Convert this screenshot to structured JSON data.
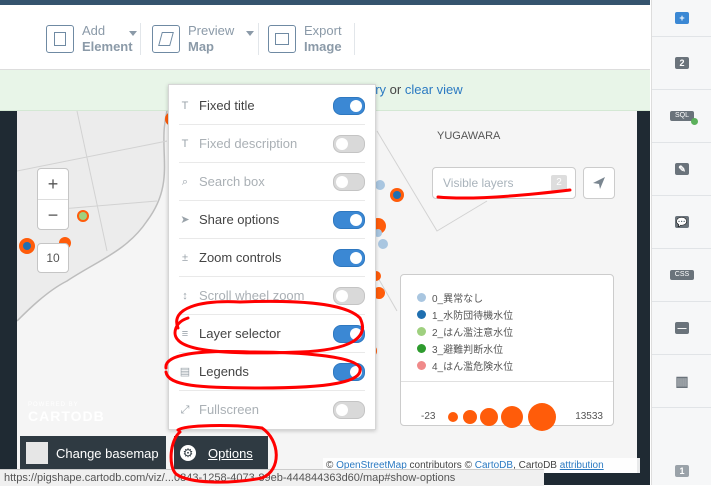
{
  "toolbar": {
    "add_element": {
      "line1": "Add",
      "line2": "Element"
    },
    "preview_map": {
      "line1": "Preview",
      "line2": "Map"
    },
    "export_image": {
      "line1": "Export",
      "line2": "Image"
    }
  },
  "notice": {
    "prefix": "ery",
    "middle": " or ",
    "link": "clear view"
  },
  "map": {
    "place_label": "YUGAWARA",
    "zoom_in": "+",
    "zoom_out": "−",
    "zoom_level": "10",
    "layers_label": "Visible layers",
    "layers_count": "2",
    "powered_small": "POWERED BY",
    "powered_brand": "CARTODB"
  },
  "legend": {
    "items": [
      {
        "label": "0_異常なし",
        "color": "#a9c6e0"
      },
      {
        "label": "1_水防団待機水位",
        "color": "#1f6fb0"
      },
      {
        "label": "2_はん濫注意水位",
        "color": "#9fd07f"
      },
      {
        "label": "3_避難判断水位",
        "color": "#2e9b2e"
      },
      {
        "label": "4_はん濫危険水位",
        "color": "#f08a8a"
      }
    ],
    "min": "-23",
    "max": "13533",
    "bubble_color": "#ff5c0a"
  },
  "options_panel": {
    "items": [
      {
        "label": "Fixed title",
        "on": true,
        "icon": "T"
      },
      {
        "label": "Fixed description",
        "on": false,
        "icon": "T"
      },
      {
        "label": "Search box",
        "on": false,
        "icon": "⌕"
      },
      {
        "label": "Share options",
        "on": true,
        "icon": "➤"
      },
      {
        "label": "Zoom controls",
        "on": true,
        "icon": "±"
      },
      {
        "label": "Scroll wheel zoom",
        "on": false,
        "icon": "↕"
      },
      {
        "label": "Layer selector",
        "on": true,
        "icon": "≡"
      },
      {
        "label": "Legends",
        "on": true,
        "icon": "▤"
      },
      {
        "label": "Fullscreen",
        "on": false,
        "icon": "⤢"
      }
    ]
  },
  "bottom": {
    "change_basemap": "Change basemap",
    "options": "Options"
  },
  "attribution": {
    "copy1": "© ",
    "osm": "OpenStreetMap",
    "mid": " contributors © ",
    "cartodb": "CartoDB",
    "end": ", CartoDB ",
    "attr": "attribution"
  },
  "status_url": "https://pigshape.cartodb.com/viz/...0843-1258-4073-89eb-444844363d60/map#show-options",
  "right_sidebar": {
    "items": [
      "+",
      "2",
      "SQL",
      "✎",
      "💬",
      "CSS",
      "—",
      "▥",
      "1"
    ]
  },
  "colors": {
    "accent": "#3b88d4",
    "annotation_red": "#ff0000",
    "header_bar": "#35546e"
  }
}
